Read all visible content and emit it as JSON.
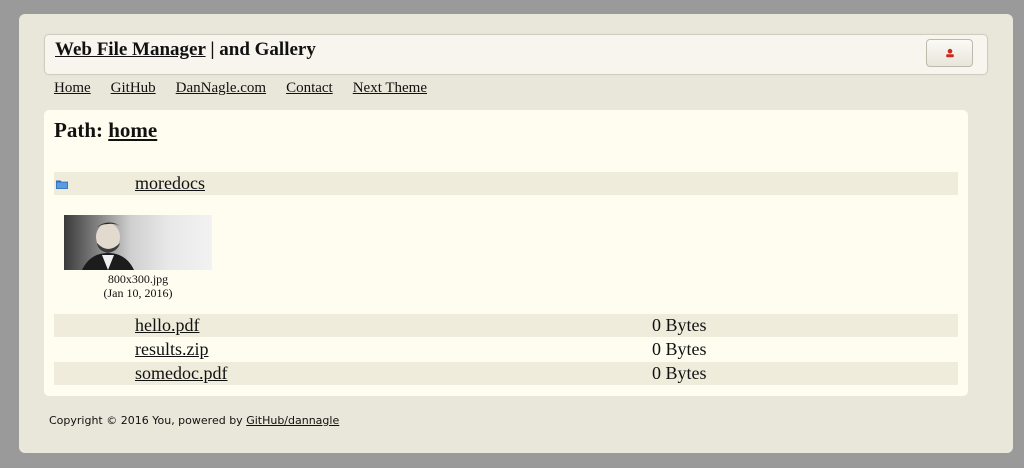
{
  "header": {
    "title_link": "Web File Manager",
    "title_rest": " | and Gallery",
    "user_button_icon": "user-icon"
  },
  "nav": {
    "items": [
      "Home",
      "GitHub",
      "DanNagle.com",
      "Contact",
      "Next Theme"
    ]
  },
  "main": {
    "path_label": "Path: ",
    "path_value": "home",
    "folders": [
      {
        "name": "moredocs",
        "icon": "folder-icon"
      }
    ],
    "gallery": [
      {
        "filename": "800x300.jpg",
        "date": "(Jan 10, 2016)"
      }
    ],
    "files": [
      {
        "name": "hello.pdf",
        "size": "0 Bytes"
      },
      {
        "name": "results.zip",
        "size": "0 Bytes"
      },
      {
        "name": "somedoc.pdf",
        "size": "0 Bytes"
      }
    ]
  },
  "footer": {
    "text": "Copyright © 2016 You, powered by ",
    "link": "GitHub/dannagle"
  },
  "colors": {
    "outer_bg": "#9a9a9a",
    "frame_bg": "#e9e6da",
    "panel_bg": "#fefdf0",
    "row_bg": "#f0ecdc",
    "folder_blue": "#2f6fb8",
    "user_icon_red": "#d0281e"
  }
}
